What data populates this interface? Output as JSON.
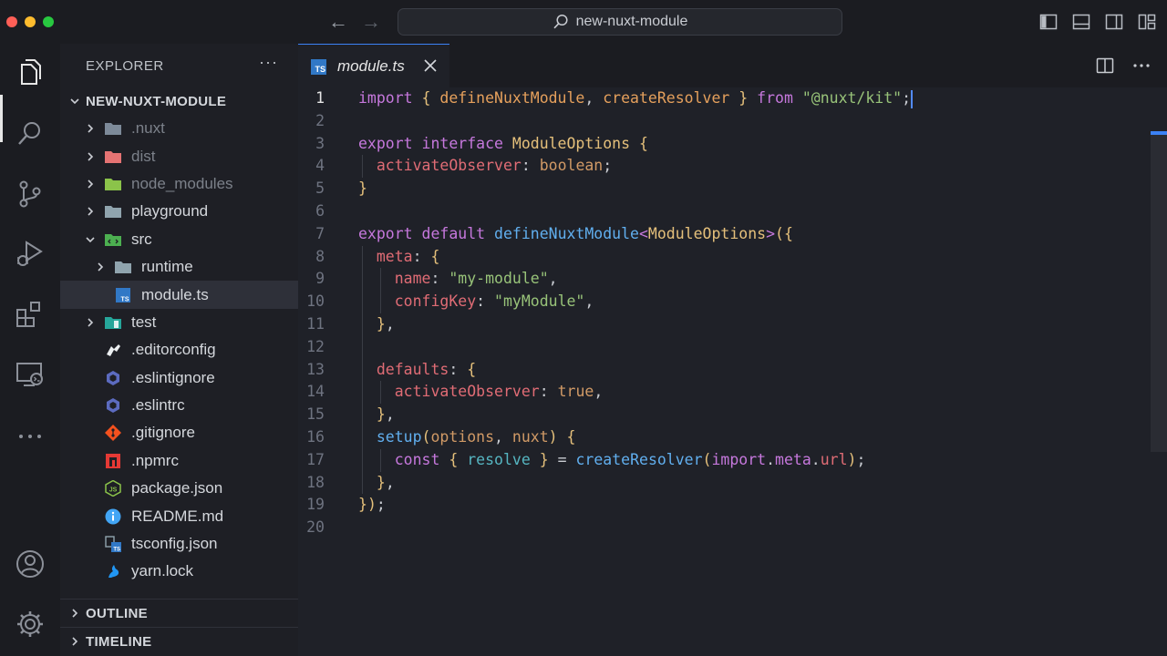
{
  "window": {
    "search_label": "new-nuxt-module"
  },
  "activity_bar": {
    "items": [
      "explorer-icon",
      "search-icon",
      "source-control-icon",
      "run-debug-icon",
      "extensions-icon",
      "remote-explorer-icon",
      "more-icon",
      "account-icon",
      "settings-gear-icon"
    ]
  },
  "sidebar": {
    "title": "EXPLORER",
    "more": "···",
    "root": "NEW-NUXT-MODULE",
    "items": [
      {
        "label": ".nuxt",
        "type": "folder",
        "depth": 1,
        "dim": true,
        "expanded": false
      },
      {
        "label": "dist",
        "type": "folder",
        "depth": 1,
        "dim": true,
        "expanded": false
      },
      {
        "label": "node_modules",
        "type": "folder",
        "depth": 1,
        "dim": true,
        "expanded": false
      },
      {
        "label": "playground",
        "type": "folder",
        "depth": 1,
        "dim": false,
        "expanded": false
      },
      {
        "label": "src",
        "type": "folder",
        "depth": 1,
        "dim": false,
        "expanded": true
      },
      {
        "label": "runtime",
        "type": "folder",
        "depth": 2,
        "dim": false,
        "expanded": false
      },
      {
        "label": "module.ts",
        "type": "file",
        "depth": 2,
        "dim": false,
        "selected": true
      },
      {
        "label": "test",
        "type": "folder",
        "depth": 1,
        "dim": false,
        "expanded": false
      },
      {
        "label": ".editorconfig",
        "type": "file",
        "depth": 1,
        "dim": false
      },
      {
        "label": ".eslintignore",
        "type": "file",
        "depth": 1,
        "dim": false
      },
      {
        "label": ".eslintrc",
        "type": "file",
        "depth": 1,
        "dim": false
      },
      {
        "label": ".gitignore",
        "type": "file",
        "depth": 1,
        "dim": false
      },
      {
        "label": ".npmrc",
        "type": "file",
        "depth": 1,
        "dim": false
      },
      {
        "label": "package.json",
        "type": "file",
        "depth": 1,
        "dim": false
      },
      {
        "label": "README.md",
        "type": "file",
        "depth": 1,
        "dim": false
      },
      {
        "label": "tsconfig.json",
        "type": "file",
        "depth": 1,
        "dim": false
      },
      {
        "label": "yarn.lock",
        "type": "file",
        "depth": 1,
        "dim": false
      }
    ],
    "outline_label": "OUTLINE",
    "timeline_label": "TIMELINE"
  },
  "editor": {
    "tab_label": "module.ts",
    "tab_icon_text": "TS",
    "line_numbers": [
      "1",
      "2",
      "3",
      "4",
      "5",
      "6",
      "7",
      "8",
      "9",
      "10",
      "11",
      "12",
      "13",
      "14",
      "15",
      "16",
      "17",
      "18",
      "19",
      "20"
    ],
    "current_line": "1",
    "code_lines": [
      "import { defineNuxtModule, createResolver } from \"@nuxt/kit\";",
      "",
      "export interface ModuleOptions {",
      "  activateObserver: boolean;",
      "}",
      "",
      "export default defineNuxtModule<ModuleOptions>({",
      "  meta: {",
      "    name: \"my-module\",",
      "    configKey: \"myModule\",",
      "  },",
      "",
      "  defaults: {",
      "    activateObserver: true,",
      "  },",
      "  setup(options, nuxt) {",
      "    const { resolve } = createResolver(import.meta.url);",
      "  },",
      "});",
      ""
    ]
  }
}
